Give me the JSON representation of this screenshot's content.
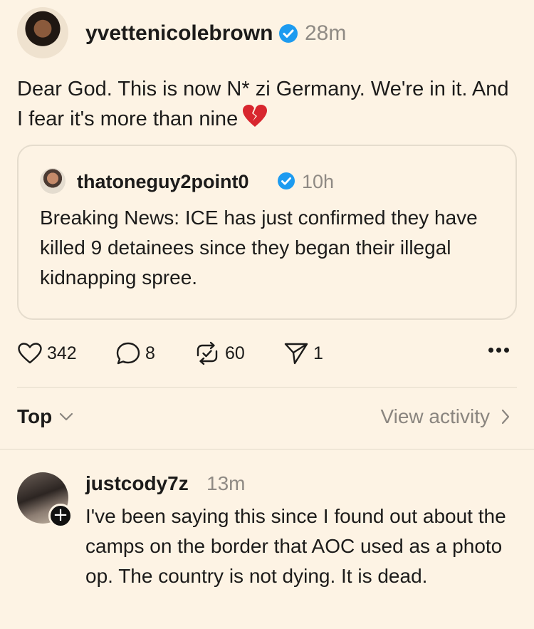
{
  "post": {
    "username": "yvettenicolebrown",
    "time": "28m",
    "text": "Dear God. This is now N* zi Germany. We're in it. And I fear it's more than nine",
    "emoji": "broken-heart"
  },
  "quote": {
    "username": "thatoneguy2point0",
    "time": "10h",
    "text": "Breaking News: ICE has just confirmed they have killed 9 detainees since they began their illegal kidnapping spree."
  },
  "actions": {
    "likes": "342",
    "replies": "8",
    "reposts": "60",
    "shares": "1"
  },
  "sort": {
    "label": "Top",
    "view_activity": "View activity"
  },
  "reply": {
    "username": "justcody7z",
    "time": "13m",
    "follow_glyph": "+",
    "text": "I've been saying this since I found out about the camps on the border that AOC used as a photo op. The country is not dying. It is dead."
  },
  "colors": {
    "background": "#fdf3e4",
    "verified": "#1d9bf0",
    "muted": "#8f8a84"
  },
  "icons": [
    "heart-icon",
    "comment-icon",
    "repost-icon",
    "share-icon",
    "more-icon",
    "chevron-down-icon",
    "chevron-right-icon",
    "verified-icon"
  ]
}
